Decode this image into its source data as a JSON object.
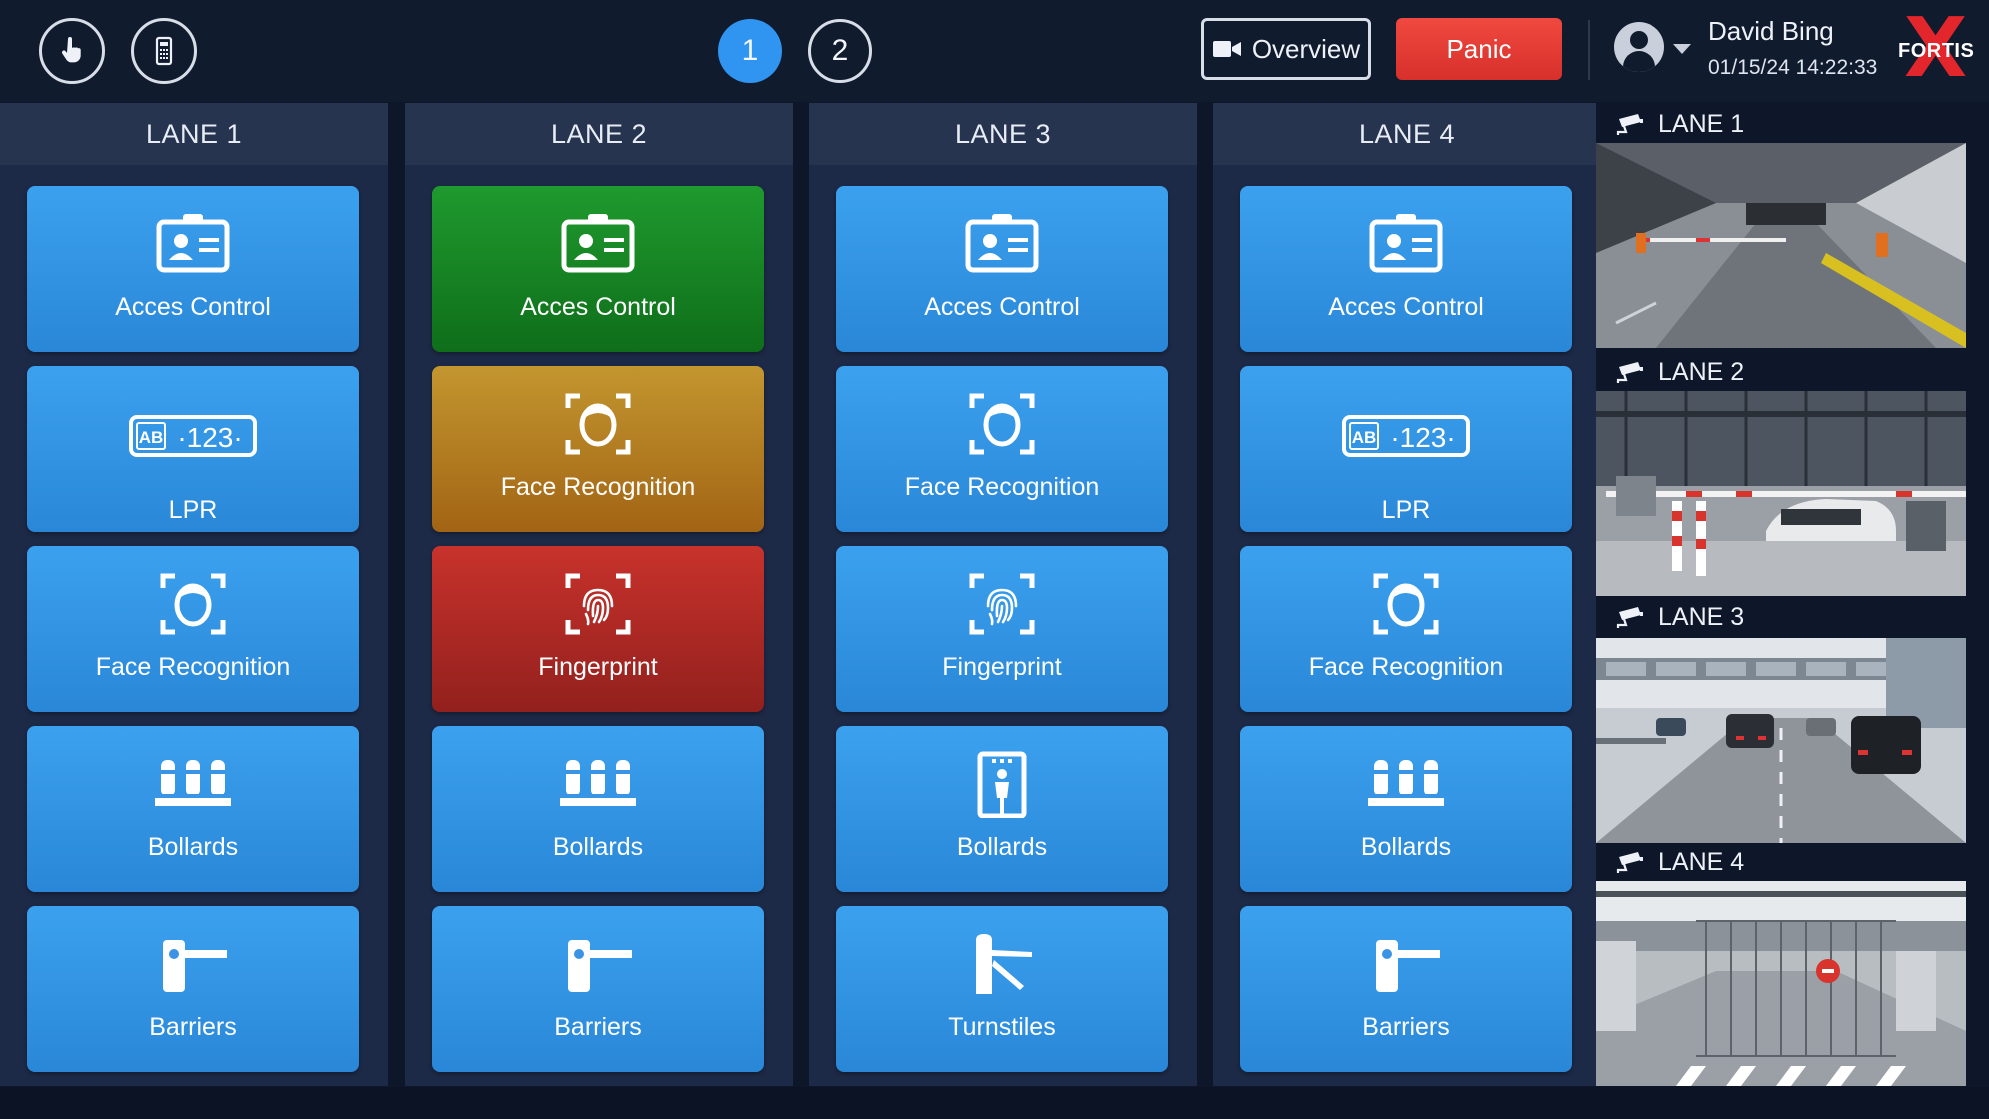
{
  "header": {
    "touch_icon": "hand-pointer-icon",
    "keypad_icon": "keypad-icon",
    "pages": [
      {
        "label": "1",
        "active": true
      },
      {
        "label": "2",
        "active": false
      }
    ],
    "overview_label": "Overview",
    "panic_label": "Panic",
    "user_name": "David Bing",
    "date_time": "01/15/24   14:22:33",
    "logo_text": "FORTIS",
    "colors": {
      "active_page": "#2f95f0",
      "panic": "#e2393a"
    }
  },
  "lanes": [
    {
      "title": "LANE 1",
      "tiles": [
        {
          "label": "Acces Control",
          "icon": "id-card-icon",
          "state": "default"
        },
        {
          "label": "LPR",
          "icon": "license-plate-icon",
          "state": "default"
        },
        {
          "label": "Face Recognition",
          "icon": "face-scan-icon",
          "state": "default"
        },
        {
          "label": "Bollards",
          "icon": "bollards-icon",
          "state": "default"
        },
        {
          "label": "Barriers",
          "icon": "barrier-icon",
          "state": "default"
        }
      ]
    },
    {
      "title": "LANE 2",
      "tiles": [
        {
          "label": "Acces Control",
          "icon": "id-card-icon",
          "state": "green"
        },
        {
          "label": "Face Recognition",
          "icon": "face-scan-icon",
          "state": "amber"
        },
        {
          "label": "Fingerprint",
          "icon": "fingerprint-icon",
          "state": "red"
        },
        {
          "label": "Bollards",
          "icon": "bollards-icon",
          "state": "default"
        },
        {
          "label": "Barriers",
          "icon": "barrier-icon",
          "state": "default"
        }
      ]
    },
    {
      "title": "LANE 3",
      "tiles": [
        {
          "label": "Acces Control",
          "icon": "id-card-icon",
          "state": "default"
        },
        {
          "label": "Face Recognition",
          "icon": "face-scan-icon",
          "state": "default"
        },
        {
          "label": "Fingerprint",
          "icon": "fingerprint-icon",
          "state": "default"
        },
        {
          "label": "Bollards",
          "icon": "walkthrough-detector-icon",
          "state": "default"
        },
        {
          "label": "Turnstiles",
          "icon": "turnstile-icon",
          "state": "default"
        }
      ]
    },
    {
      "title": "LANE 4",
      "tiles": [
        {
          "label": "Acces Control",
          "icon": "id-card-icon",
          "state": "default"
        },
        {
          "label": "LPR",
          "icon": "license-plate-icon",
          "state": "default"
        },
        {
          "label": "Face Recognition",
          "icon": "face-scan-icon",
          "state": "default"
        },
        {
          "label": "Bollards",
          "icon": "bollards-icon",
          "state": "default"
        },
        {
          "label": "Barriers",
          "icon": "barrier-icon",
          "state": "default"
        }
      ]
    }
  ],
  "cameras": [
    {
      "label": "LANE 1",
      "icon": "security-camera-icon"
    },
    {
      "label": "LANE 2",
      "icon": "security-camera-icon"
    },
    {
      "label": "LANE 3",
      "icon": "security-camera-icon"
    },
    {
      "label": "LANE 4",
      "icon": "security-camera-icon"
    }
  ],
  "plate_text": {
    "prefix": "AB",
    "number": "·123·"
  }
}
